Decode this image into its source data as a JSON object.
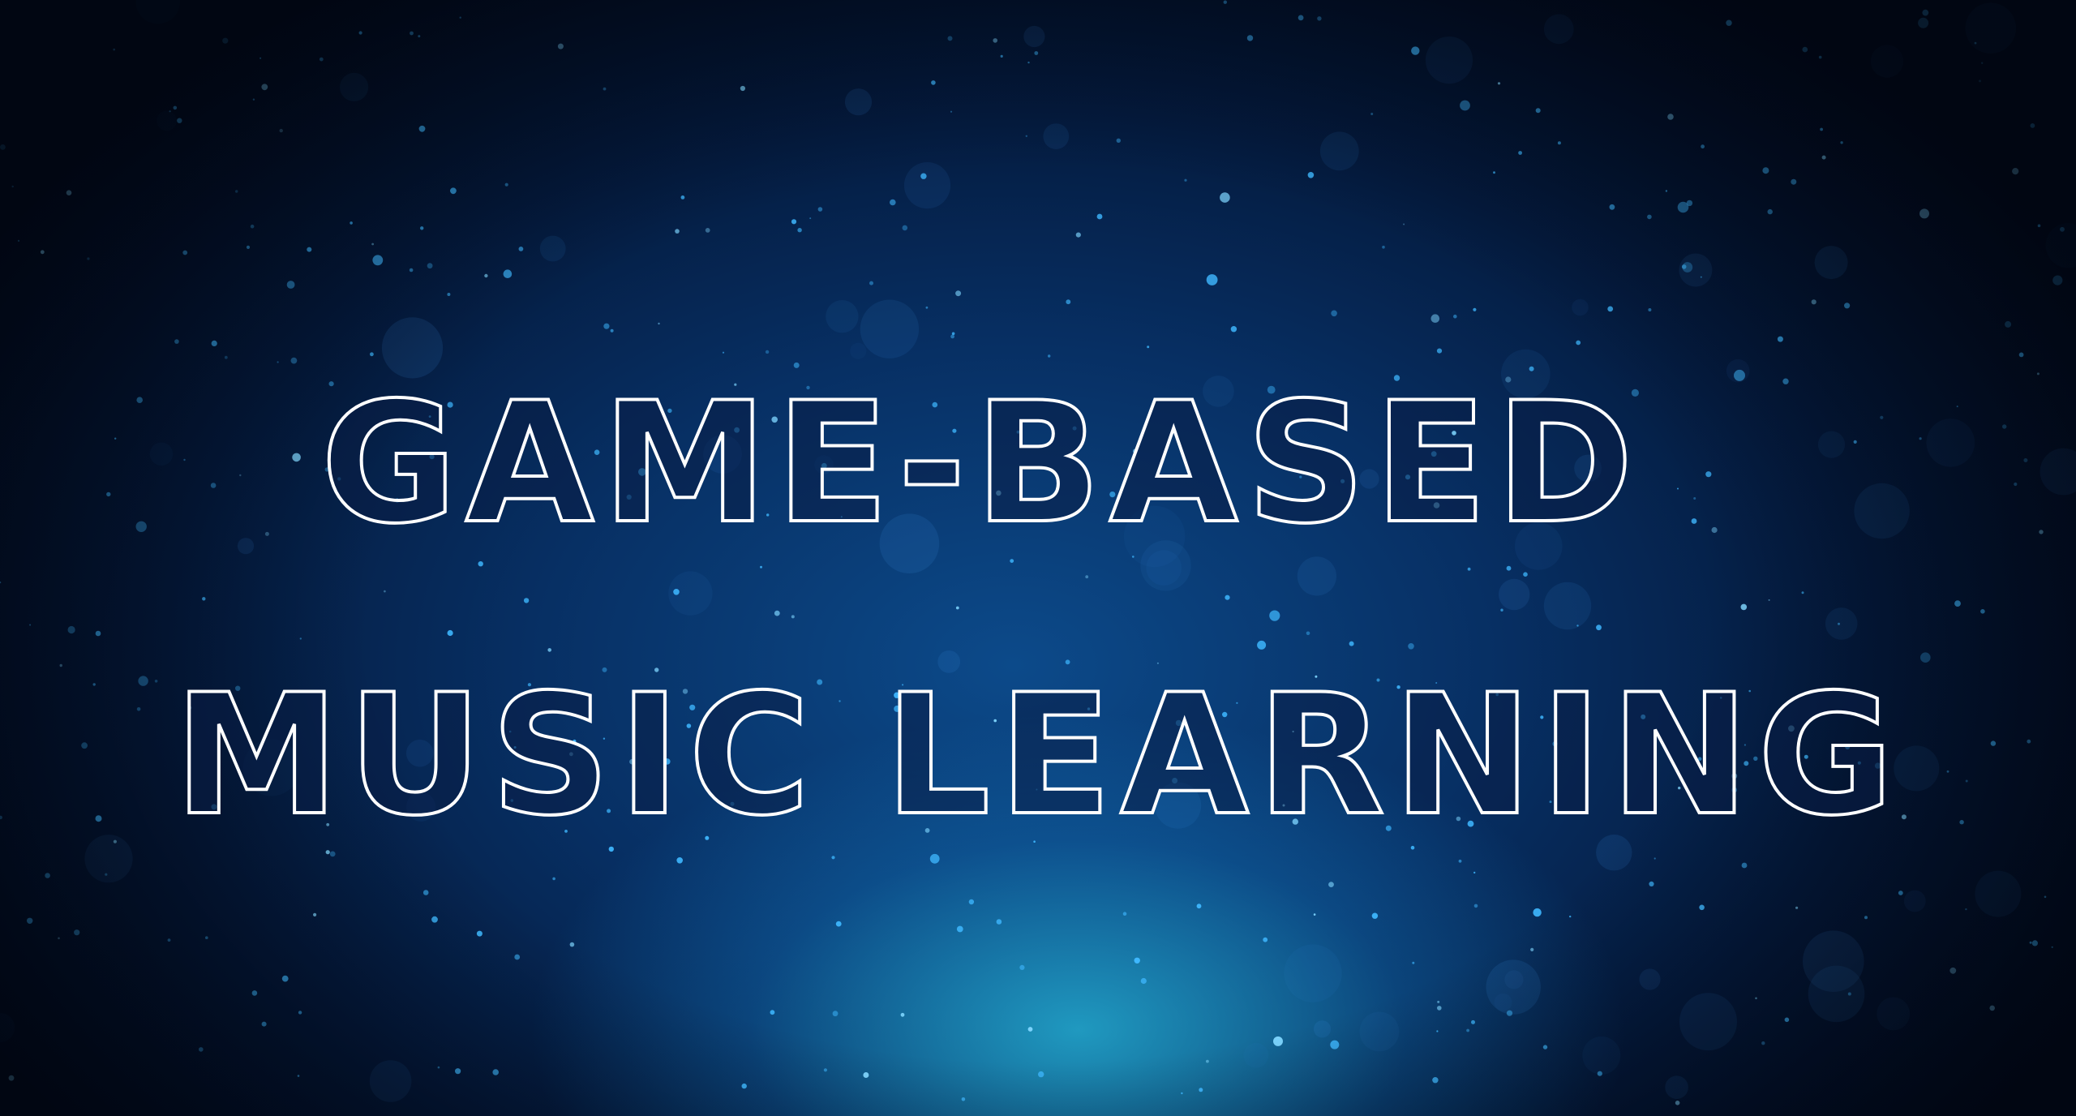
{
  "title": {
    "line1": "GAME-BASED",
    "line2": "MUSIC LEARNING"
  },
  "colors": {
    "background_dark": "#020b1c",
    "background_blue": "#072f63",
    "glow_cyan": "#28bee1",
    "particle": "#3fb8ff",
    "text_stroke": "#ffffff"
  }
}
